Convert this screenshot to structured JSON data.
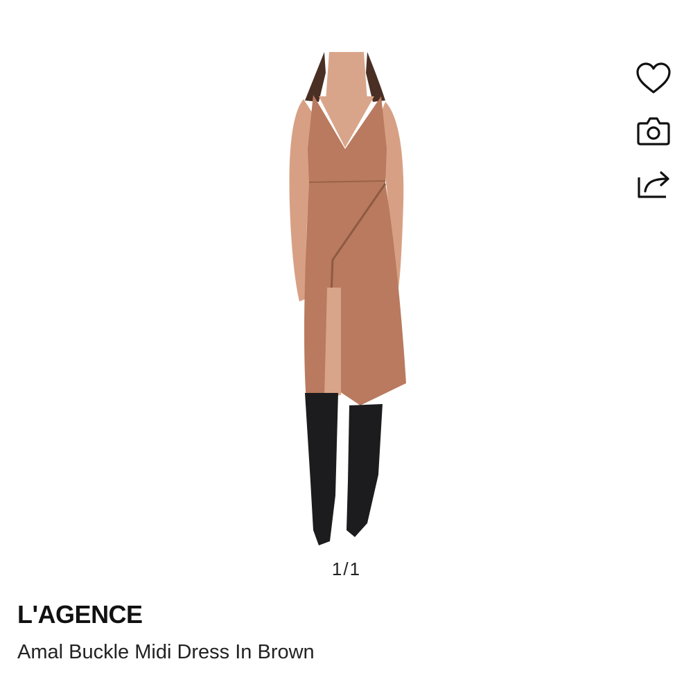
{
  "gallery": {
    "image_alt": "Amal Buckle Midi Dress In Brown",
    "pager": "1/1",
    "dress_color": "#b97a5f"
  },
  "actions": {
    "favorite_icon": "heart-icon",
    "camera_icon": "camera-icon",
    "share_icon": "share-icon"
  },
  "product": {
    "brand": "L'AGENCE",
    "name": "Amal Buckle Midi Dress In Brown"
  }
}
